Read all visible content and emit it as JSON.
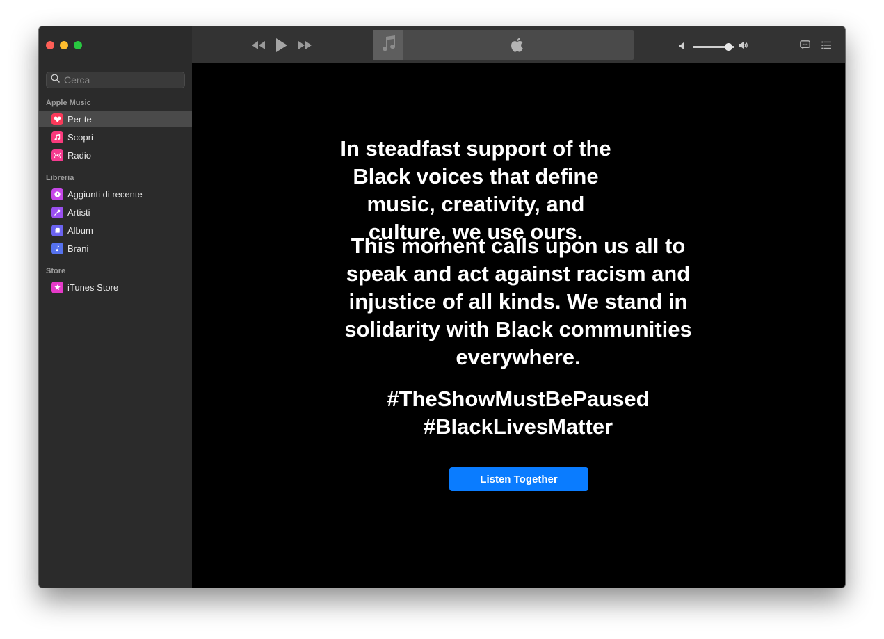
{
  "sidebar": {
    "search_placeholder": "Cerca",
    "sections": [
      {
        "label": "Apple Music",
        "items": [
          {
            "label": "Per te",
            "icon": "heart-icon",
            "color": "#fa3a5a",
            "active": true
          },
          {
            "label": "Scopri",
            "icon": "music-note-icon",
            "color": "#fa3a7c"
          },
          {
            "label": "Radio",
            "icon": "radio-waves-icon",
            "color": "#f53b8f"
          }
        ]
      },
      {
        "label": "Libreria",
        "items": [
          {
            "label": "Aggiunti di recente",
            "icon": "clock-icon",
            "color": "#c648e8"
          },
          {
            "label": "Artisti",
            "icon": "microphone-icon",
            "color": "#9a4ff0"
          },
          {
            "label": "Album",
            "icon": "album-icon",
            "color": "#6b63f0"
          },
          {
            "label": "Brani",
            "icon": "music-note-icon",
            "color": "#5672ee"
          }
        ]
      },
      {
        "label": "Store",
        "items": [
          {
            "label": "iTunes Store",
            "icon": "star-icon",
            "color": "#e63ac9"
          }
        ]
      }
    ]
  },
  "toolbar": {
    "volume_level": 0.85
  },
  "main": {
    "paragraph1": "In steadfast support of the Black voices that define music, creativity, and culture, we use ours.",
    "paragraph2": "This moment calls upon us all to speak and act against racism and injustice of all kinds. We stand in solidarity with Black communities everywhere.",
    "hashtag1": "#TheShowMustBePaused",
    "hashtag2": "#BlackLivesMatter",
    "button_label": "Listen Together",
    "button_color": "#0a7cff"
  }
}
